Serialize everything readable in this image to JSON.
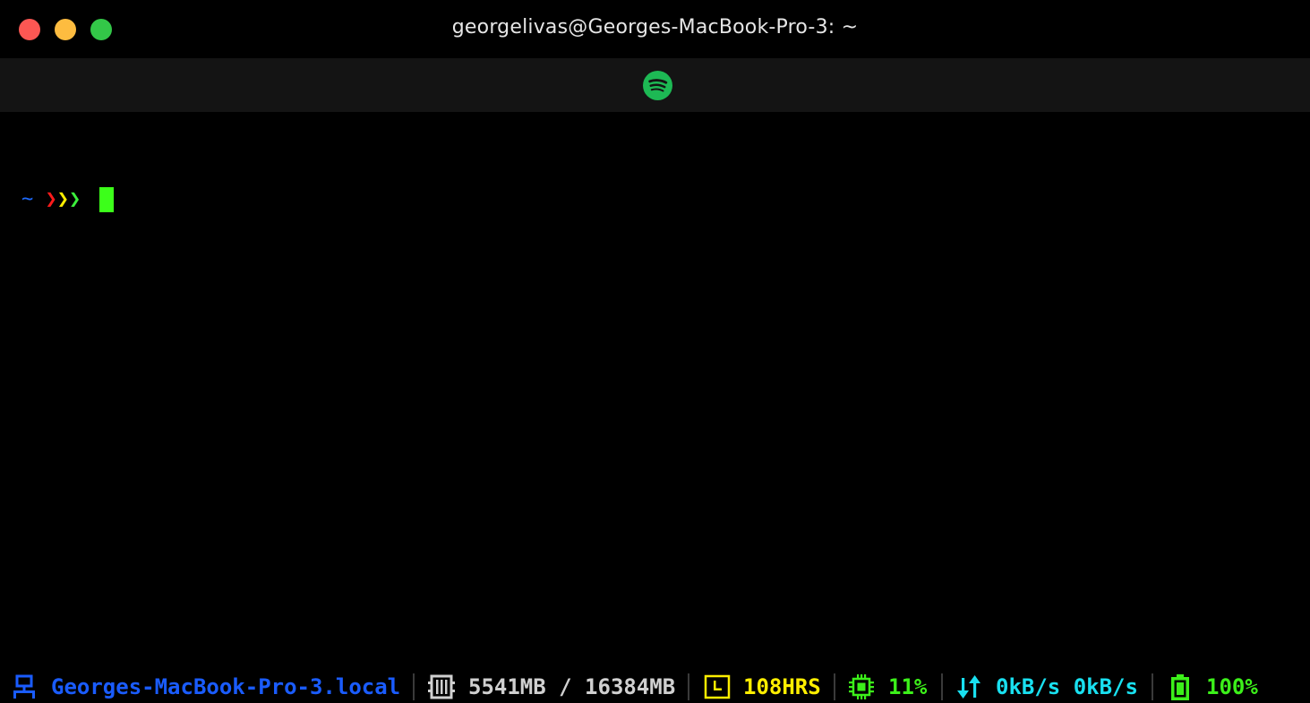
{
  "window": {
    "title": "georgelivas@Georges-MacBook-Pro-3: ~"
  },
  "tab": {
    "icon": "spotify-icon",
    "icon_color": "#1db954"
  },
  "prompt": {
    "tilde": "~",
    "arrows": [
      "❯",
      "❯",
      "❯"
    ],
    "colors": {
      "tilde": "#1e6bff",
      "arrow1": "#ff1b1b",
      "arrow2": "#ffee00",
      "arrow3": "#3cf03c",
      "cursor": "#3cff1a"
    }
  },
  "statusbar": {
    "hostname": "Georges-MacBook-Pro-3.local",
    "memory": "5541MB / 16384MB",
    "uptime": "108HRS",
    "cpu": "11%",
    "network": "0kB/s 0kB/s",
    "battery": "100%",
    "icons": {
      "host": "network-icon",
      "memory": "memory-icon",
      "uptime": "clock-icon",
      "cpu": "cpu-icon",
      "network": "up-down-arrows-icon",
      "battery": "battery-icon"
    },
    "colors": {
      "hostname": "#1a5cff",
      "memory": "#d0d0d0",
      "uptime": "#ffee00",
      "cpu": "#3cf01a",
      "network": "#19e0f0",
      "battery": "#3cf01a"
    }
  }
}
